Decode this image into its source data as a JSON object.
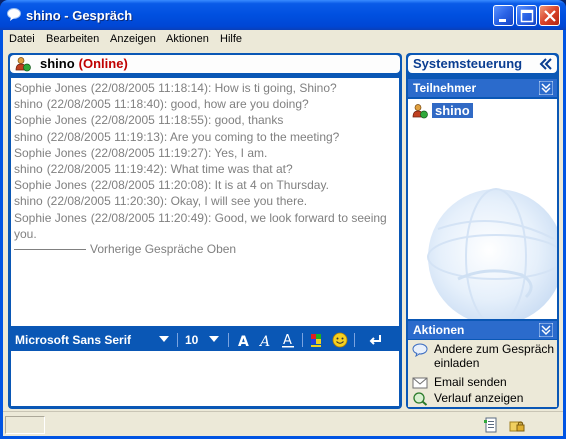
{
  "window": {
    "title": "shino - Gespräch",
    "title_icon": "chat-bubble-icon",
    "controls": [
      "minimize-icon",
      "maximize-icon",
      "close-icon"
    ]
  },
  "menu": {
    "items": [
      "Datei",
      "Bearbeiten",
      "Anzeigen",
      "Aktionen",
      "Hilfe"
    ]
  },
  "chat": {
    "contact_name": "shino",
    "contact_status": "(Online)",
    "messages": [
      {
        "sender": "Sophie Jones",
        "time": "(22/08/2005 11:18:14):",
        "text": "How is ti going, Shino?"
      },
      {
        "sender": "shino",
        "time": "(22/08/2005 11:18:40):",
        "text": "good, how are you doing?"
      },
      {
        "sender": "Sophie Jones",
        "time": "(22/08/2005 11:18:55):",
        "text": "good, thanks"
      },
      {
        "sender": "shino",
        "time": "(22/08/2005 11:19:13):",
        "text": "Are you coming to the meeting?"
      },
      {
        "sender": "Sophie Jones",
        "time": "(22/08/2005 11:19:27):",
        "text": "Yes, I am."
      },
      {
        "sender": "shino",
        "time": "(22/08/2005 11:19:42):",
        "text": "What time was that at?"
      },
      {
        "sender": "Sophie Jones",
        "time": "(22/08/2005 11:20:08):",
        "text": "It is at 4 on Thursday."
      },
      {
        "sender": "shino",
        "time": "(22/08/2005 11:20:30):",
        "text": "Okay, I will see you there."
      },
      {
        "sender": "Sophie Jones",
        "time": "(22/08/2005 11:20:49):",
        "text": "Good, we look forward to seeing you."
      }
    ],
    "history_label": "Vorherige Gespräche Oben"
  },
  "format_toolbar": {
    "font_name": "Microsoft Sans Serif",
    "font_size": "10",
    "buttons": [
      "bold-a-icon",
      "italic-a-icon",
      "underline-a-icon",
      "color-palette-icon",
      "emoticon-smiley-icon",
      "send-enter-icon"
    ]
  },
  "compose": {
    "value": ""
  },
  "sidebar": {
    "title": "Systemsteuerung",
    "participants_title": "Teilnehmer",
    "participants": [
      {
        "name": "shino",
        "icon": "buddy-online-icon"
      }
    ],
    "actions_title": "Aktionen",
    "actions": [
      {
        "label": "Andere zum Gespräch einladen",
        "icon": "invite-bubble-icon"
      },
      {
        "label": "Email senden",
        "icon": "envelope-icon"
      },
      {
        "label": "Verlauf anzeigen",
        "icon": "history-magnifier-icon"
      }
    ]
  },
  "statusbar": {
    "icons": [
      "contact-card-icon",
      "lock-folder-icon"
    ]
  },
  "colors": {
    "titlebar": "#0054e3",
    "panel_blue": "#0a57b5",
    "status_online": "#c00000",
    "selection": "#316ac5"
  }
}
